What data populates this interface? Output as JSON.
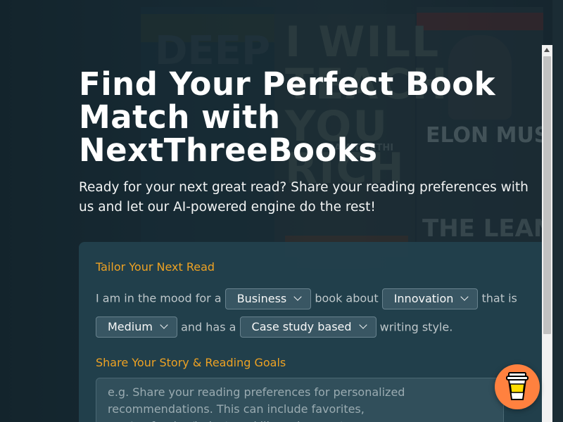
{
  "hero": {
    "title": "Find Your Perfect Book Match with NextThreeBooks",
    "subtitle": "Ready for your next great read? Share your reading preferences with us and let our AI-powered engine do the rest!"
  },
  "background": {
    "cover_texts": [
      "I WILL TEACH YOU TO BE RICH",
      "ELON MUSK",
      "THE LEAN",
      "RAMIT SETHI",
      "DEEP"
    ]
  },
  "tailor": {
    "title": "Tailor Your Next Read",
    "text_1": "I am in the mood for a",
    "genre": {
      "value": "Business"
    },
    "text_2": "book about",
    "topic": {
      "value": "Innovation"
    },
    "text_3": "that is",
    "length": {
      "value": "Medium"
    },
    "text_4": "and has a",
    "style": {
      "value": "Case study based"
    },
    "text_5": "writing style."
  },
  "story": {
    "title": "Share Your Story & Reading Goals",
    "placeholder": "e.g. Share your reading preferences for personalized recommendations. This can include favorites, age/profession/industry, skills and current"
  },
  "coffee_button": {
    "icon": "coffee-cup-icon"
  },
  "colors": {
    "accent": "#f5a623",
    "card": "#22404c",
    "coffee": "#ff813f"
  }
}
